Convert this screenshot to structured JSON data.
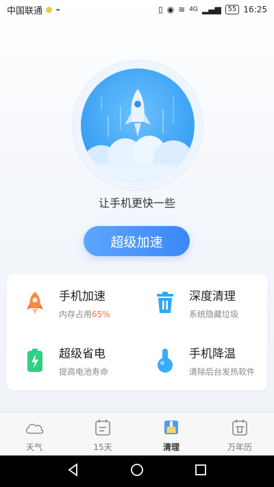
{
  "status_bar": {
    "carrier": "中国联通",
    "network": "4G",
    "battery": "55",
    "time": "16:25"
  },
  "hero": {
    "caption": "让手机更快一些",
    "button_label": "超级加速"
  },
  "features": [
    {
      "title": "手机加速",
      "subtitle_prefix": "内存占用",
      "subtitle_value": "65%",
      "icon": "rocket-icon",
      "color": "#ff8a3d"
    },
    {
      "title": "深度清理",
      "subtitle": "系统隐藏垃圾",
      "icon": "trash-icon",
      "color": "#2ea8f5"
    },
    {
      "title": "超级省电",
      "subtitle": "提高电池寿命",
      "icon": "battery-icon",
      "color": "#2fd083"
    },
    {
      "title": "手机降温",
      "subtitle": "清除后台发热软件",
      "icon": "thermometer-icon",
      "color": "#35aef6"
    }
  ],
  "bottom_nav": [
    {
      "label": "天气",
      "icon": "cloud-icon"
    },
    {
      "label": "15天",
      "icon": "calendar-list-icon"
    },
    {
      "label": "清理",
      "icon": "broom-icon",
      "active": true
    },
    {
      "label": "万年历",
      "icon": "calendar-icon"
    }
  ],
  "colors": {
    "accent": "#3b88f5",
    "highlight": "#ff6a3d"
  }
}
